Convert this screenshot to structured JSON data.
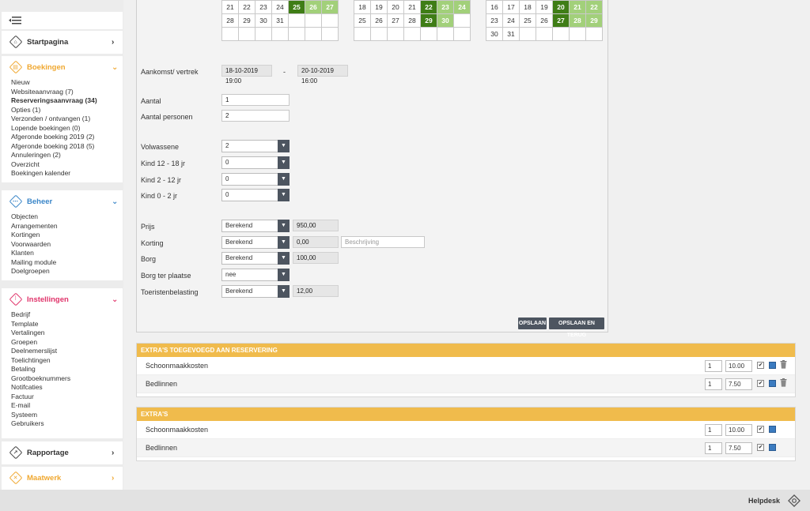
{
  "sidebar": {
    "menu_icon": "hamburger-icon",
    "startpagina": "Startpagina",
    "boekingen": {
      "title": "Boekingen",
      "color": "#f0a830",
      "items": [
        "Nieuw",
        "Websiteaanvraag (7)",
        "Reserveringsaanvraag (34)",
        "Opties (1)",
        "Verzonden / ontvangen (1)",
        "Lopende boekingen (0)",
        "Afgeronde boeking 2019 (2)",
        "Afgeronde boeking 2018 (5)",
        "Annuleringen (2)",
        "Overzicht",
        "Boekingen kalender"
      ]
    },
    "beheer": {
      "title": "Beheer",
      "color": "#3a86c8",
      "items": [
        "Objecten",
        "Arrangementen",
        "Kortingen",
        "Voorwaarden",
        "Klanten",
        "Mailing module",
        "Doelgroepen"
      ]
    },
    "instellingen": {
      "title": "Instellingen",
      "color": "#e0336a",
      "items": [
        "Bedrijf",
        "Template",
        "Vertalingen",
        "Groepen",
        "Deelnemerslijst",
        "Toelichtingen",
        "Betaling",
        "Grootboeknummers",
        "Notifcaties",
        "Factuur",
        "E-mail",
        "Systeem",
        "Gebruikers"
      ]
    },
    "rapportage": "Rapportage",
    "maatwerk": "Maatwerk",
    "maatwerk_color": "#f0a830"
  },
  "calendars": [
    [
      [
        "21",
        "22",
        "23",
        "24",
        "25",
        "26",
        "27"
      ],
      [
        "28",
        "29",
        "30",
        "31",
        "",
        "",
        ""
      ],
      [
        "",
        "",
        "",
        "",
        "",
        "",
        ""
      ]
    ],
    [
      [
        "18",
        "19",
        "20",
        "21",
        "22",
        "23",
        "24"
      ],
      [
        "25",
        "26",
        "27",
        "28",
        "29",
        "30",
        ""
      ],
      [
        "",
        "",
        "",
        "",
        "",
        "",
        ""
      ]
    ],
    [
      [
        "16",
        "17",
        "18",
        "19",
        "20",
        "21",
        "22"
      ],
      [
        "23",
        "24",
        "25",
        "26",
        "27",
        "28",
        "29"
      ],
      [
        "30",
        "31",
        "",
        "",
        "",
        "",
        ""
      ]
    ]
  ],
  "form": {
    "aankomst_label": "Aankomst/ vertrek",
    "aankomst": "18-10-2019 19:00",
    "separator": "-",
    "vertrek": "20-10-2019 16:00",
    "aantal_label": "Aantal",
    "aantal": "1",
    "personen_label": "Aantal personen",
    "personen": "2",
    "volwassene_label": "Volwassene",
    "volwassene": "2",
    "kind1218_label": "Kind 12 - 18 jr",
    "kind1218": "0",
    "kind212_label": "Kind 2 - 12 jr",
    "kind212": "0",
    "kind02_label": "Kind 0 - 2 jr",
    "kind02": "0",
    "prijs_label": "Prijs",
    "prijs_mode": "Berekend",
    "prijs": "950,00",
    "korting_label": "Korting",
    "korting_mode": "Berekend",
    "korting": "0,00",
    "beschrijving_placeholder": "Beschrijving",
    "borg_label": "Borg",
    "borg_mode": "Berekend",
    "borg": "100,00",
    "borg_tp_label": "Borg ter plaatse",
    "borg_tp": "nee",
    "toeristen_label": "Toeristenbelasting",
    "toeristen_mode": "Berekend",
    "toeristen": "12,00",
    "save": "OPSLAAN",
    "save_back": "OPSLAAN EN TERUG"
  },
  "extras_added": {
    "title": "EXTRA'S TOEGEVOEGD AAN RESERVERING",
    "rows": [
      {
        "name": "Schoonmaakkosten",
        "qty": "1",
        "price": "10.00"
      },
      {
        "name": "Bedlinnen",
        "qty": "1",
        "price": "7.50"
      }
    ]
  },
  "extras": {
    "title": "EXTRA'S",
    "rows": [
      {
        "name": "Schoonmaakkosten",
        "qty": "1",
        "price": "10.00"
      },
      {
        "name": "Bedlinnen",
        "qty": "1",
        "price": "7.50"
      }
    ]
  },
  "footer": {
    "helpdesk": "Helpdesk"
  }
}
